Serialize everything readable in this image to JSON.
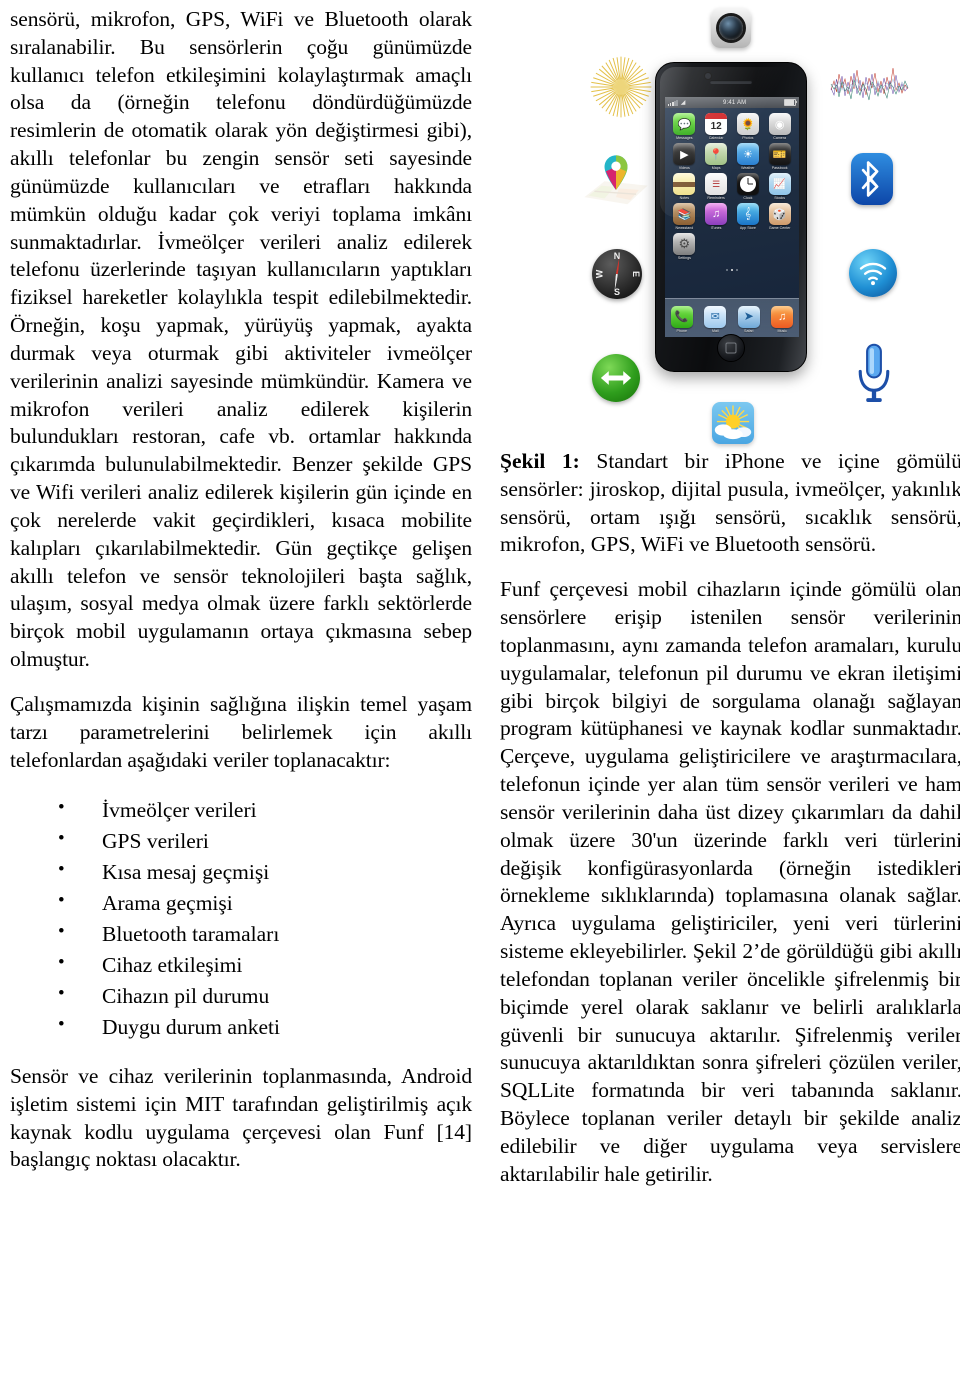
{
  "document": {
    "language": "Turkish",
    "left_column": {
      "paragraphs": [
        "sensörü, mikrofon, GPS, WiFi ve Bluetooth olarak sıralanabilir. Bu sensörlerin çoğu günümüzde kullanıcı telefon etkileşimini kolaylaştırmak amaçlı olsa da (örneğin telefonu döndürdüğümüzde resimlerin de otomatik olarak yön değiştirmesi gibi), akıllı telefonlar bu zengin sensör seti sayesinde günümüzde kullanıcıları ve etrafları hakkında mümkün olduğu kadar çok veriyi toplama imkânı sunmaktadırlar. İvmeölçer verileri analiz edilerek telefonu üzerlerinde taşıyan kullanıcıların yaptıkları fiziksel hareketler kolaylıkla tespit edilebilmektedir. Örneğin, koşu yapmak, yürüyüş yapmak, ayakta durmak veya oturmak gibi aktiviteler ivmeölçer verilerinin analizi sayesinde mümkündür. Kamera ve mikrofon verileri analiz edilerek kişilerin bulundukları restoran, cafe vb. ortamlar hakkında çıkarımda bulunulabilmektedir. Benzer şekilde GPS ve Wifi verileri analiz edilerek kişilerin gün içinde en çok nerelerde vakit geçirdikleri, kısaca mobilite kalıpları çıkarılabilmektedir. Gün geçtikçe gelişen akıllı telefon ve sensör teknolojileri başta sağlık, ulaşım, sosyal medya olmak üzere farklı sektörlerde birçok mobil uygulamanın ortaya çıkmasına sebep olmuştur.",
        "Çalışmamızda kişinin sağlığına ilişkin temel yaşam tarzı parametrelerini belirlemek için akıllı telefonlardan aşağıdaki veriler toplanacaktır:"
      ],
      "bullet_list": [
        "İvmeölçer verileri",
        "GPS verileri",
        "Kısa mesaj geçmişi",
        "Arama geçmişi",
        "Bluetooth taramaları",
        "Cihaz etkileşimi",
        "Cihazın pil durumu",
        "Duygu durum anketi"
      ],
      "closing_paragraph": "Sensör ve cihaz verilerinin toplanmasında, Android işletim sistemi için MIT tarafından geliştirilmiş açık kaynak kodlu uygulama çerçevesi olan Funf [14] başlangıç noktası olacaktır."
    },
    "right_column": {
      "figure": {
        "label": "Şekil 1:",
        "caption_text": " Standart bir iPhone ve içine gömülü sensörler: jiroskop, dijital pusula, ivmeölçer, yakınlık sensörü, ortam ışığı sensörü, sıcaklık sensörü, mikrofon, GPS, WiFi ve Bluetooth sensörü.",
        "phone": {
          "status_time": "9:41 AM",
          "apps_page1": [
            {
              "name": "Messages",
              "label": "Messages"
            },
            {
              "name": "Calendar",
              "label": "Calendar",
              "day": "12"
            },
            {
              "name": "Photos",
              "label": "Photos"
            },
            {
              "name": "Camera",
              "label": "Camera"
            },
            {
              "name": "Videos",
              "label": "Videos"
            },
            {
              "name": "Maps",
              "label": "Maps"
            },
            {
              "name": "Weather",
              "label": "Weather"
            },
            {
              "name": "Passbook",
              "label": "Passbook"
            },
            {
              "name": "Notes",
              "label": "Notes"
            },
            {
              "name": "Reminders",
              "label": "Reminders"
            },
            {
              "name": "Clock",
              "label": "Clock"
            },
            {
              "name": "Stocks",
              "label": "Stocks"
            },
            {
              "name": "Newsstand",
              "label": "Newsstand"
            },
            {
              "name": "iTunes",
              "label": "iTunes"
            },
            {
              "name": "App Store",
              "label": "App Store"
            },
            {
              "name": "Game Center",
              "label": "Game Center"
            },
            {
              "name": "Settings",
              "label": "Settings"
            }
          ],
          "dock_apps": [
            {
              "name": "Phone",
              "label": "Phone"
            },
            {
              "name": "Mail",
              "label": "Mail"
            },
            {
              "name": "Safari",
              "label": "Safari"
            },
            {
              "name": "Music",
              "label": "Music"
            }
          ]
        },
        "sensor_icons": [
          {
            "id": "camera-sensor-icon",
            "position": "top-center",
            "color": "#c9c9c9"
          },
          {
            "id": "ambient-light-sensor-icon",
            "position": "top-left",
            "color": "#e8c84a"
          },
          {
            "id": "gps-sensor-icon",
            "position": "mid-left-upper",
            "color": "#23b5c8"
          },
          {
            "id": "digital-compass-icon",
            "position": "mid-left-lower",
            "color": "#d5342c"
          },
          {
            "id": "proximity-sensor-icon",
            "position": "bottom-left",
            "color": "#2f9e1d"
          },
          {
            "id": "accelerometer-signal-icon",
            "position": "top-right",
            "color": "#8a5fb0"
          },
          {
            "id": "bluetooth-sensor-icon",
            "position": "mid-right-upper",
            "color": "#0d46a8"
          },
          {
            "id": "wifi-sensor-icon",
            "position": "mid-right-mid",
            "color": "#1f8fd4"
          },
          {
            "id": "microphone-sensor-icon",
            "position": "bottom-right",
            "color": "#2f7fe0"
          },
          {
            "id": "temperature-sensor-icon",
            "position": "bottom-center",
            "color": "#4aa6e2"
          }
        ]
      },
      "paragraphs": [
        "Funf çerçevesi mobil cihazların içinde gömülü olan sensörlere erişip istenilen sensör verilerinin toplanmasını, aynı zamanda telefon aramaları, kurulu uygulamalar, telefonun pil durumu ve ekran iletişimi gibi birçok bilgiyi de sorgulama olanağı sağlayan program kütüphanesi ve kaynak kodlar sunmaktadır. Çerçeve, uygulama geliştiricilere ve araştırmacılara, telefonun içinde yer alan tüm sensör verileri ve ham sensör verilerinin daha üst dizey çıkarımları da dahil olmak üzere 30'un üzerinde farklı veri türlerini değişik konfigürasyonlarda (örneğin istedikleri örnekleme sıklıklarında) toplamasına olanak sağlar. Ayrıca uygulama geliştiriciler, yeni veri türlerini sisteme ekleyebilirler. Şekil 2’de görüldüğü gibi akıllı telefondan toplanan veriler öncelikle şifrelenmiş bir biçimde yerel olarak saklanır ve belirli aralıklarla güvenli bir sunucuya aktarılır. Şifrelenmiş veriler sunucuya aktarıldıktan sonra şifreleri çözülen veriler, SQLLite formatında bir veri tabanında saklanır. Böylece toplanan veriler detaylı bir şekilde analiz edilebilir ve diğer uygulama veya servislere aktarılabilir hale getirilir."
      ]
    }
  }
}
